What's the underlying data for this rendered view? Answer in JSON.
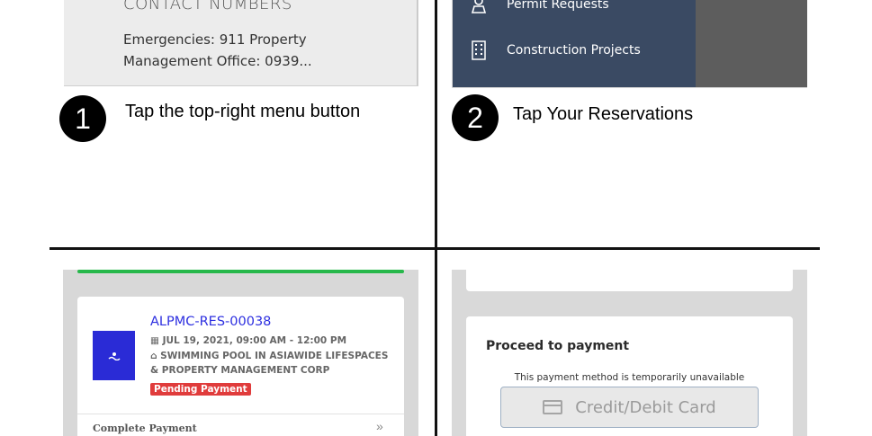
{
  "panel1": {
    "heading": "CONTACT NUMBERS",
    "body": "Emergencies: 911 Property Management Office: 0939...",
    "step_number": "1",
    "step_text": "Tap the top-right menu button"
  },
  "panel2": {
    "menu_items": [
      {
        "label": "Permit Requests",
        "icon": "person-icon"
      },
      {
        "label": "Construction Projects",
        "icon": "building-icon"
      }
    ],
    "step_number": "2",
    "step_text": "Tap Your Reservations"
  },
  "panel3": {
    "reservation_id": "ALPMC-RES-00038",
    "datetime": "JUL 19, 2021, 09:00 AM - 12:00 PM",
    "venue_line1": "SWIMMING POOL IN ASIAWIDE LIFESPACES",
    "venue_line2": "& PROPERTY MANAGEMENT CORP",
    "status": "Pending Payment",
    "action": "Complete Payment"
  },
  "panel4": {
    "title": "Proceed to payment",
    "note": "This payment method is temporarily unavailable",
    "button": "Credit/Debit Card"
  },
  "colors": {
    "menu_bg": "#3a4a63",
    "accent_blue": "#2d2fe0",
    "badge_red": "#e03c3c",
    "progress_green": "#27b84b"
  }
}
